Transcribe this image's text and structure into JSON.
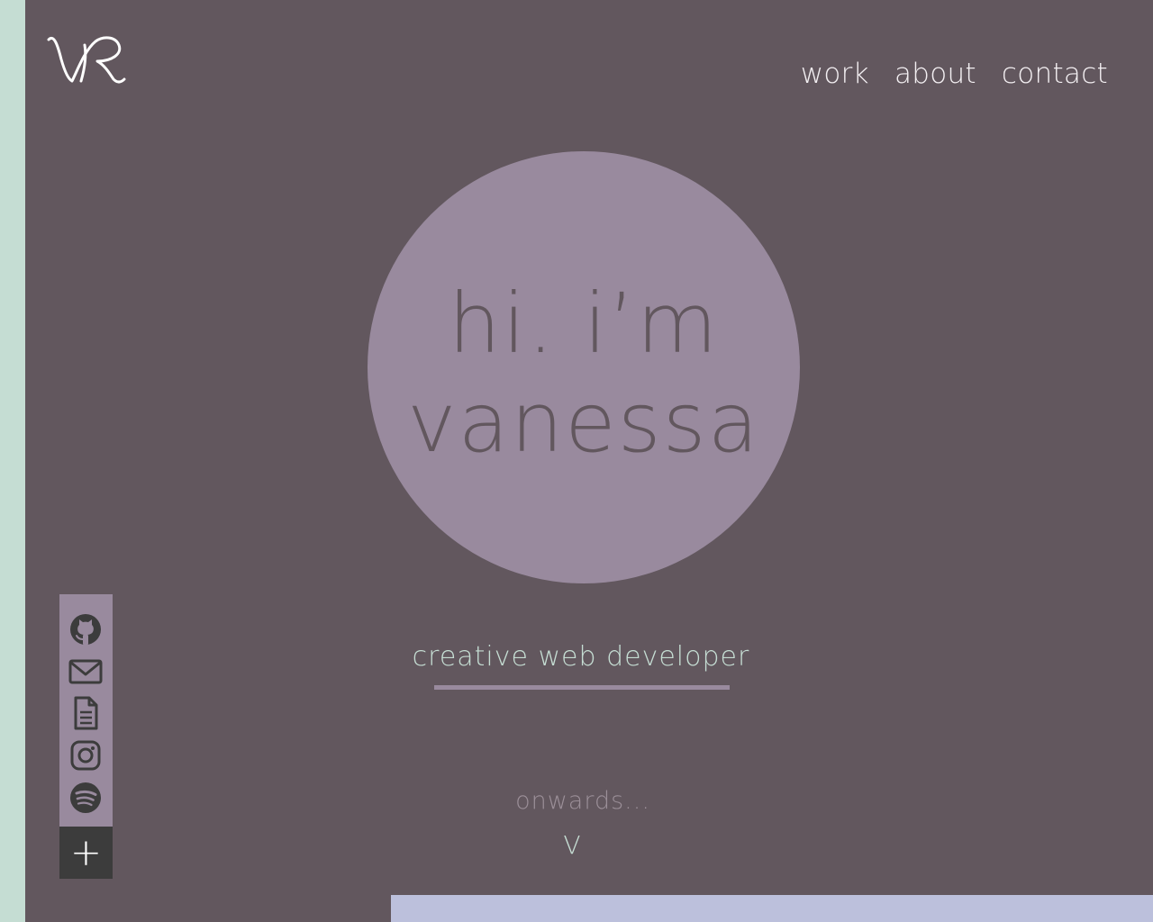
{
  "logo": {
    "initials": "VR"
  },
  "nav": {
    "items": [
      "work",
      "about",
      "contact"
    ]
  },
  "hero": {
    "line1": "hi. i’m",
    "line2": "vanessa"
  },
  "tagline": "creative web developer",
  "onwards": {
    "label": "onwards...",
    "chevron": "V"
  },
  "social": {
    "icons": [
      "github-icon",
      "mail-icon",
      "document-icon",
      "instagram-icon",
      "spotify-icon"
    ],
    "toggle_label": "+"
  },
  "colors": {
    "background": "#62575e",
    "accent_mint": "#c5ddd3",
    "circle": "#998a9e",
    "nav_text": "#f3eff2",
    "icon": "#3c3c3c",
    "bottom_block": "#bcc0dc"
  }
}
